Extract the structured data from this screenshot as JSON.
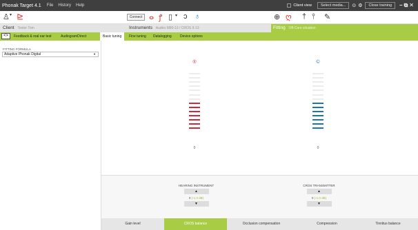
{
  "app": {
    "title": "Phonak Target 4.1"
  },
  "menu": [
    "File",
    "History",
    "Help"
  ],
  "titlebar_right": {
    "client_view": "Client view",
    "select_media": "Select media...",
    "close_training": "Close training"
  },
  "toolbar": {
    "connect": "Connect"
  },
  "info": {
    "client_label": "Client",
    "client_name": "Tester Tom",
    "instruments_label": "Instruments",
    "instruments_detail": "Audéo M90-13 / CROS II-13",
    "fitting_label": "Fitting",
    "fitting_detail": "Off-Care situation"
  },
  "tabs": [
    "Feedback & real ear test",
    "AudiogramDirect",
    "Basic tuning",
    "Fine tuning",
    "Datalogging",
    "Device options"
  ],
  "active_tab": "Basic tuning",
  "sidebar": {
    "formula_label": "FITTING FORMULA",
    "formula_value": "Adaptive Phonak Digital"
  },
  "ears": {
    "right": {
      "symbol": "®",
      "color": "#d02a3a",
      "active_bars": 7,
      "total_bars": 14,
      "value": "0"
    },
    "left": {
      "symbol": "©",
      "color": "#1a75b8",
      "active_bars": 7,
      "total_bars": 14,
      "value": "0"
    }
  },
  "controls": {
    "hi": {
      "title": "HEARING INSTRUMENT",
      "value": "0",
      "unit": "(-1.0 dB)"
    },
    "cros": {
      "title": "CROS TRANSMITTER",
      "value": "0",
      "unit": "(-1.0 dB)"
    },
    "up": "▲",
    "down": "▼"
  },
  "bottom_tabs": [
    "Gain level",
    "CROS balance",
    "Occlusion compensation",
    "Compression",
    "Tinnitus balance"
  ],
  "active_bottom_tab": "CROS balance",
  "accent": "#a8cc44"
}
